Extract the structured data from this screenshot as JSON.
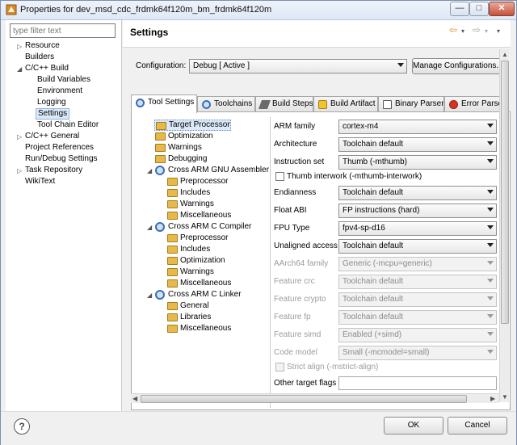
{
  "window": {
    "title": "Properties for dev_msd_cdc_frdmk64f120m_bm_frdmk64f120m",
    "min_glyph": "—",
    "max_glyph": "□",
    "close_glyph": "✕"
  },
  "filter": {
    "placeholder": "type filter text"
  },
  "nav_tree": {
    "items": [
      {
        "label": "Resource"
      },
      {
        "label": "Builders"
      },
      {
        "label": "C/C++ Build"
      },
      {
        "label": "Build Variables"
      },
      {
        "label": "Environment"
      },
      {
        "label": "Logging"
      },
      {
        "label": "Settings"
      },
      {
        "label": "Tool Chain Editor"
      },
      {
        "label": "C/C++ General"
      },
      {
        "label": "Project References"
      },
      {
        "label": "Run/Debug Settings"
      },
      {
        "label": "Task Repository"
      },
      {
        "label": "WikiText"
      }
    ]
  },
  "page": {
    "title": "Settings"
  },
  "config": {
    "label": "Configuration:",
    "value": "Debug  [ Active ]",
    "manage_button": "Manage Configurations..."
  },
  "tabs": [
    {
      "label": "Tool Settings"
    },
    {
      "label": "Toolchains"
    },
    {
      "label": "Build Steps"
    },
    {
      "label": "Build Artifact"
    },
    {
      "label": "Binary Parsers"
    },
    {
      "label": "Error Parse"
    }
  ],
  "tool_tree": {
    "items": [
      {
        "label": "Target Processor"
      },
      {
        "label": "Optimization"
      },
      {
        "label": "Warnings"
      },
      {
        "label": "Debugging"
      },
      {
        "label": "Cross ARM GNU Assembler"
      },
      {
        "label": "Preprocessor"
      },
      {
        "label": "Includes"
      },
      {
        "label": "Warnings"
      },
      {
        "label": "Miscellaneous"
      },
      {
        "label": "Cross ARM C Compiler"
      },
      {
        "label": "Preprocessor"
      },
      {
        "label": "Includes"
      },
      {
        "label": "Optimization"
      },
      {
        "label": "Warnings"
      },
      {
        "label": "Miscellaneous"
      },
      {
        "label": "Cross ARM C Linker"
      },
      {
        "label": "General"
      },
      {
        "label": "Libraries"
      },
      {
        "label": "Miscellaneous"
      }
    ]
  },
  "props": {
    "arm_family": {
      "label": "ARM family",
      "value": "cortex-m4"
    },
    "architecture": {
      "label": "Architecture",
      "value": "Toolchain default"
    },
    "instruction_set": {
      "label": "Instruction set",
      "value": "Thumb (-mthumb)"
    },
    "thumb_interwork": {
      "label": "Thumb interwork (-mthumb-interwork)"
    },
    "endianness": {
      "label": "Endianness",
      "value": "Toolchain default"
    },
    "float_abi": {
      "label": "Float ABI",
      "value": "FP instructions (hard)"
    },
    "fpu_type": {
      "label": "FPU Type",
      "value": "fpv4-sp-d16"
    },
    "unaligned_access": {
      "label": "Unaligned access",
      "value": "Toolchain default"
    },
    "aarch64_family": {
      "label": "AArch64 family",
      "value": "Generic (-mcpu=generic)"
    },
    "feature_crc": {
      "label": "Feature crc",
      "value": "Toolchain default"
    },
    "feature_crypto": {
      "label": "Feature crypto",
      "value": "Toolchain default"
    },
    "feature_fp": {
      "label": "Feature fp",
      "value": "Toolchain default"
    },
    "feature_simd": {
      "label": "Feature simd",
      "value": "Enabled (+simd)"
    },
    "code_model": {
      "label": "Code model",
      "value": "Small (-mcmodel=small)"
    },
    "strict_align": {
      "label": "Strict align (-mstrict-align)"
    },
    "other_target_flags": {
      "label": "Other target flags",
      "value": ""
    }
  },
  "footer": {
    "help_glyph": "?",
    "ok_label": "OK",
    "cancel_label": "Cancel"
  }
}
